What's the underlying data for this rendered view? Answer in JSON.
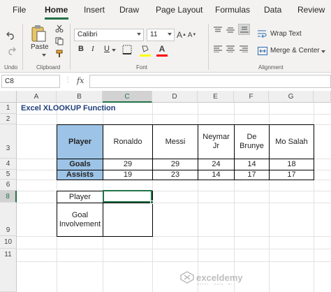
{
  "ribbon": {
    "tabs": [
      "File",
      "Home",
      "Insert",
      "Draw",
      "Page Layout",
      "Formulas",
      "Data",
      "Review"
    ],
    "active_tab": "Home",
    "groups": {
      "undo": "Undo",
      "clipboard": "Clipboard",
      "font": "Font",
      "alignment": "Alignment"
    },
    "paste_label": "Paste",
    "font_name": "Calibri",
    "font_size": "11",
    "wrap_text": "Wrap Text",
    "merge_center": "Merge & Center",
    "bold": "B",
    "italic": "I",
    "underline": "U",
    "font_color_letter": "A",
    "font_color": "#ff0000",
    "fill_color": "#ffff00",
    "accent": "#217346"
  },
  "formula_bar": {
    "name_box": "C8",
    "fx": "fx",
    "formula": ""
  },
  "grid": {
    "columns": [
      "A",
      "B",
      "C",
      "D",
      "E",
      "F",
      "G"
    ],
    "selected_column": "C",
    "rows": [
      "1",
      "2",
      "3",
      "4",
      "5",
      "6",
      "7",
      "8",
      "9",
      "10",
      "11"
    ],
    "selected_row": "8"
  },
  "sheet": {
    "title": "Excel XLOOKUP Function",
    "table": {
      "header_label": "Player",
      "players": [
        "Ronaldo",
        "Messi",
        "Neymar Jr",
        "De Brunye",
        "Mo Salah"
      ],
      "rows": [
        {
          "label": "Goals",
          "values": [
            "29",
            "29",
            "24",
            "14",
            "18"
          ]
        },
        {
          "label": "Assists",
          "values": [
            "19",
            "23",
            "14",
            "17",
            "17"
          ]
        }
      ]
    },
    "lookup": {
      "player_label": "Player",
      "player_value": "",
      "goal_involvement_label": "Goal Involvement",
      "goal_involvement_value": ""
    },
    "header_fill": "#9dc3e6"
  },
  "watermark": {
    "brand": "exceldemy",
    "tagline": "EXCEL · DATA · BI"
  }
}
